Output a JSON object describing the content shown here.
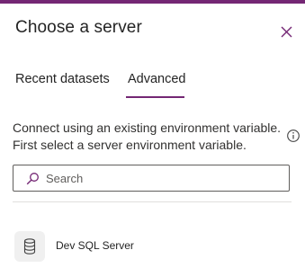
{
  "dialog": {
    "title": "Choose a server",
    "close_icon": "close-icon"
  },
  "tabs": [
    {
      "label": "Recent datasets",
      "selected": false
    },
    {
      "label": "Advanced",
      "selected": true
    }
  ],
  "description": {
    "line1": "Connect using an existing environment variable.",
    "line2": "First select a server environment variable.",
    "info_icon": "info-icon"
  },
  "search": {
    "placeholder": "Search",
    "value": "",
    "icon": "search-icon"
  },
  "servers": [
    {
      "label": "Dev SQL Server",
      "icon": "database-icon"
    }
  ],
  "colors": {
    "accent": "#742774",
    "text": "#242424",
    "border": "#605e5c",
    "divider": "#e1dfdd",
    "icon_bg": "#f0f0f0"
  }
}
